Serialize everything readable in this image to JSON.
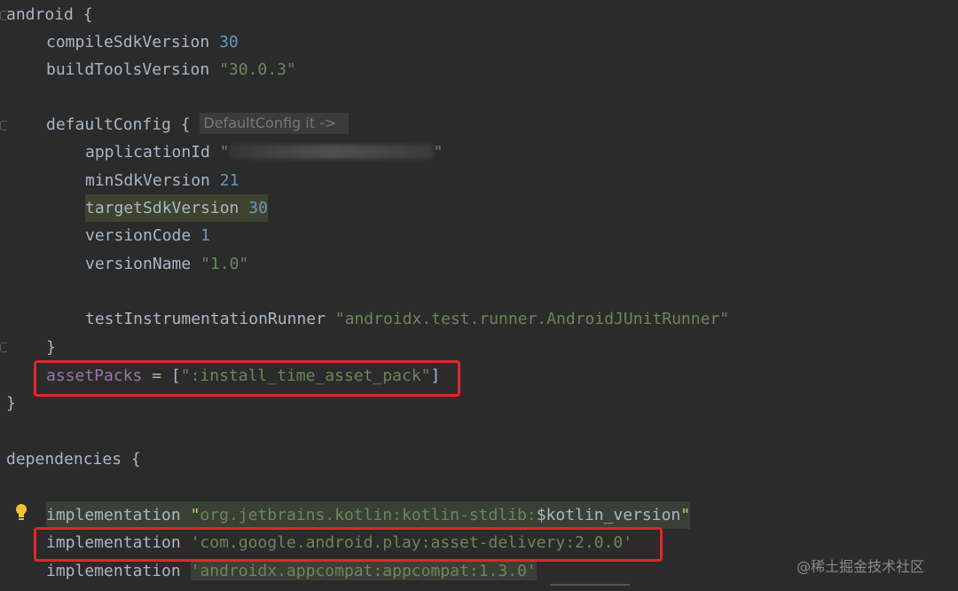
{
  "code": {
    "l1": "android {",
    "l2": {
      "kw": "compileSdkVersion",
      "val": "30"
    },
    "l3": {
      "kw": "buildToolsVersion",
      "val": "\"30.0.3\""
    },
    "l4": {
      "kw": "defaultConfig {",
      "hint": "DefaultConfig it ->"
    },
    "l5": {
      "kw": "applicationId",
      "q1": "\"",
      "q2": "\""
    },
    "l6": {
      "kw": "minSdkVersion",
      "val": "21"
    },
    "l7": {
      "kw": "targetSdkVersion",
      "val": "30"
    },
    "l8": {
      "kw": "versionCode",
      "val": "1"
    },
    "l9": {
      "kw": "versionName",
      "val": "\"1.0\""
    },
    "l10": {
      "kw": "testInstrumentationRunner",
      "val": "\"androidx.test.runner.AndroidJUnitRunner\""
    },
    "l11": "}",
    "l12": {
      "prop": "assetPacks",
      "op": " = [",
      "val": "\":install_time_asset_pack\"",
      "close": "]"
    },
    "l13": "}",
    "l14": "dependencies {",
    "l15": {
      "kw": "implementation",
      "q1": "\"",
      "val": "org.jetbrains.kotlin:kotlin-stdlib:",
      "var": "$kotlin_version",
      "q2": "\""
    },
    "l16": {
      "kw": "implementation",
      "val": "'com.google.android.play:asset-delivery:2.0.0'"
    },
    "l17": {
      "kw": "implementation",
      "val": "'androidx.appcompat:appcompat:1.3.0'"
    }
  },
  "watermark": "@稀土掘金技术社区",
  "colors": {
    "keyword": "#a9b7c6",
    "number": "#6897bb",
    "string": "#6a8759",
    "property": "#9876aa",
    "highlight_box": "#e0262a"
  }
}
